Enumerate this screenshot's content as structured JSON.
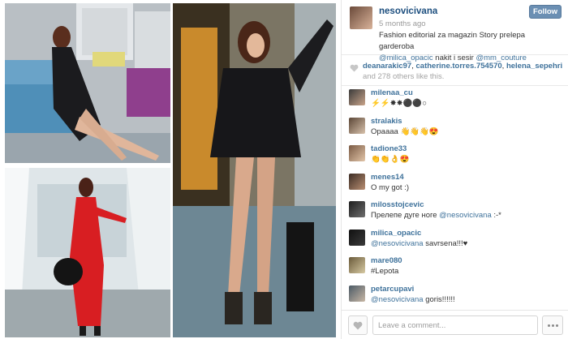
{
  "post": {
    "username": "nesovicivana",
    "time_ago": "5 months ago",
    "follow_label": "Follow",
    "caption": {
      "text": "Fashion editorial za magazin Story prelepa garderoba",
      "mention1": "@milica_opacic",
      "middle": " nakit i sesir ",
      "mention2": "@mm_couture"
    }
  },
  "likes": {
    "user1": "deanarakic97",
    "user2": "catherine.torres.754570",
    "user3": "helena_sepehri",
    "rest": "and 278 others like this."
  },
  "comments": [
    {
      "user": "milenaa_cu",
      "text": "⚡⚡✸✸⚫⚫○"
    },
    {
      "user": "stralakis",
      "text": "Opaaaa 👋👋👋😍"
    },
    {
      "user": "tadione33",
      "text": "👏👏👌😍"
    },
    {
      "user": "menes14",
      "text": "O my got :)"
    },
    {
      "user": "milosstojcevic",
      "text": "Прелепе дуге ноге ",
      "mention": "@nesovicivana",
      "after": " :-*"
    },
    {
      "user": "milica_opacic",
      "text": "",
      "mention": "@nesovicivana",
      "after": " savrsena!!!♥"
    },
    {
      "user": "mare080",
      "text": "#Lepota"
    },
    {
      "user": "petarcupavi",
      "text": "",
      "mention": "@nesovicivana",
      "after": " goris!!!!!!"
    }
  ],
  "footer": {
    "comment_placeholder": "Leave a comment..."
  },
  "colors": {
    "link": "#3f729b",
    "follow_button": "#6b8fb3",
    "muted": "#9a9a9a"
  }
}
